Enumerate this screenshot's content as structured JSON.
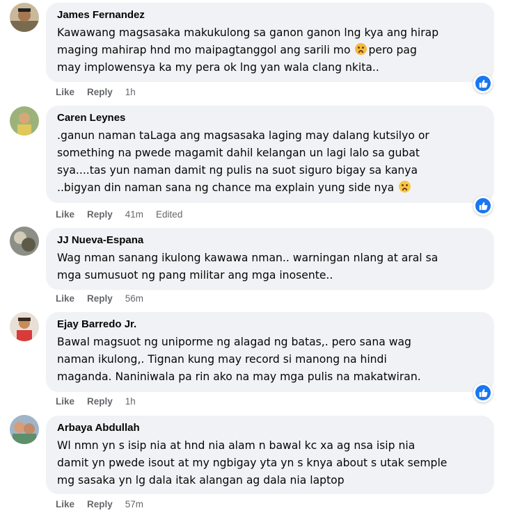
{
  "comments": [
    {
      "name": "James Fernandez",
      "lines": [
        "Kawawang magsasaka makukulong sa ganon ganon lng kya ang hirap",
        "maging mahirap hnd mo maipagtanggol ang sarili mo",
        "may implowensya ka my pera ok lng yan wala clang nkita.."
      ],
      "emoji_line_suffix": "pero pag",
      "emoji": "crying-face",
      "like": "Like",
      "reply": "Reply",
      "time": "1h",
      "edited": "",
      "reaction": "like-icon"
    },
    {
      "name": "Caren Leynes",
      "lines": [
        ".ganun naman taLaga ang magsasaka laging may dalang kutsilyo or",
        "something na pwede magamit dahil kelangan un lagi lalo sa gubat",
        "sya....tas yun naman damit ng pulis na suot siguro bigay sa kanya",
        "..bigyan din naman sana ng chance ma explain yung side nya"
      ],
      "emoji": "sad-face",
      "like": "Like",
      "reply": "Reply",
      "time": "41m",
      "edited": "Edited",
      "reaction": "like-icon"
    },
    {
      "name": "JJ Nueva-Espana",
      "lines": [
        "Wag nman sanang ikulong kawawa nman.. warningan nlang at aral sa",
        "mga sumusuot ng pang militar ang mga inosente.."
      ],
      "like": "Like",
      "reply": "Reply",
      "time": "56m",
      "edited": ""
    },
    {
      "name": "Ejay Barredo Jr.",
      "lines": [
        "Bawal magsuot ng uniporme ng alagad ng batas,. pero sana wag",
        "naman ikulong,. Tignan kung may record si manong na hindi",
        "maganda. Naniniwala pa rin ako na may mga pulis na makatwiran."
      ],
      "like": "Like",
      "reply": "Reply",
      "time": "1h",
      "edited": "",
      "reaction": "like-icon"
    },
    {
      "name": "Arbaya Abdullah",
      "lines": [
        "Wl nmn yn s isip nia at hnd nia alam n bawal kc xa ag nsa isip nia",
        "damit yn pwede isout at my ngbigay yta yn s knya about s utak semple",
        "mg sasaka yn lg dala itak alangan ag dala nia laptop"
      ],
      "like": "Like",
      "reply": "Reply",
      "time": "57m",
      "edited": ""
    }
  ],
  "colors": {
    "bubble": "#f0f2f5",
    "secondary_text": "#65676b",
    "like_blue": "#1877f2"
  }
}
